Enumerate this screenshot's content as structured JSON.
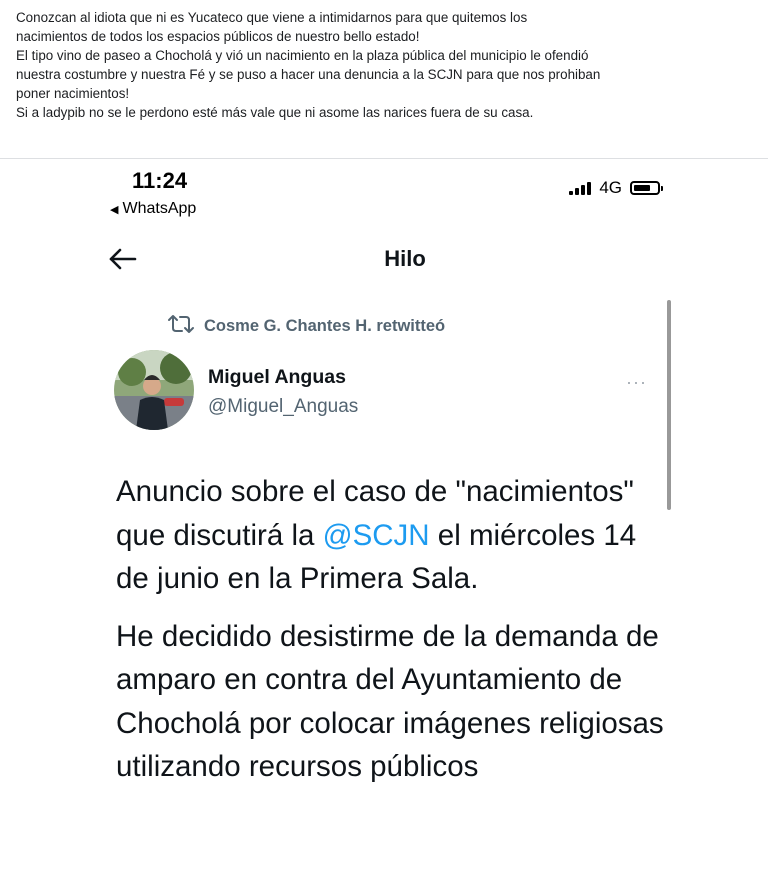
{
  "post": {
    "caption_lines": [
      "Conozcan al idiota que ni es Yucateco que viene a intimidarnos para que quitemos los",
      "nacimientos de todos los espacios públicos de nuestro bello estado!",
      "El tipo vino de paseo a Chocholá y vió un nacimiento en la plaza pública del municipio le ofendió",
      "nuestra costumbre y nuestra Fé y se puso a hacer una denuncia a la SCJN para que nos prohiban",
      "poner nacimientos!",
      "Si a ladypib no se le perdono esté más vale que ni asome las narices fuera de su casa."
    ]
  },
  "status_bar": {
    "time": "11:24",
    "back_app": "WhatsApp",
    "network": "4G"
  },
  "nav": {
    "title": "Hilo"
  },
  "tweet": {
    "retweeted_by": "Cosme G. Chantes H. retwitteó",
    "author_name": "Miguel Anguas",
    "author_handle": "@Miguel_Anguas",
    "more_label": "···",
    "para1_before": "Anuncio sobre el caso de \"nacimientos\" que discutirá la ",
    "mention": "@SCJN",
    "para1_after": " el miércoles 14 de junio en la Primera Sala.",
    "para2": "He decidido desistirme de la demanda de amparo en contra del Ayuntamiento de Chocholá por colocar imágenes religiosas utilizando recursos públicos"
  },
  "colors": {
    "mention": "#1d9bf0",
    "secondary_text": "#536471",
    "primary_text": "#0f1419"
  }
}
